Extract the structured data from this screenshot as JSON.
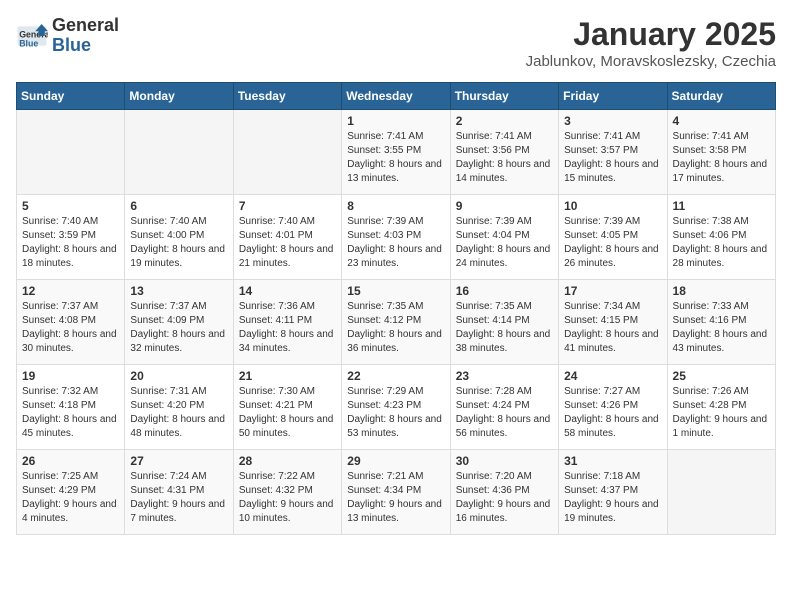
{
  "header": {
    "logo_general": "General",
    "logo_blue": "Blue",
    "title": "January 2025",
    "subtitle": "Jablunkov, Moravskoslezsky, Czechia"
  },
  "weekdays": [
    "Sunday",
    "Monday",
    "Tuesday",
    "Wednesday",
    "Thursday",
    "Friday",
    "Saturday"
  ],
  "weeks": [
    [
      {
        "day": "",
        "info": ""
      },
      {
        "day": "",
        "info": ""
      },
      {
        "day": "",
        "info": ""
      },
      {
        "day": "1",
        "info": "Sunrise: 7:41 AM\nSunset: 3:55 PM\nDaylight: 8 hours\nand 13 minutes."
      },
      {
        "day": "2",
        "info": "Sunrise: 7:41 AM\nSunset: 3:56 PM\nDaylight: 8 hours\nand 14 minutes."
      },
      {
        "day": "3",
        "info": "Sunrise: 7:41 AM\nSunset: 3:57 PM\nDaylight: 8 hours\nand 15 minutes."
      },
      {
        "day": "4",
        "info": "Sunrise: 7:41 AM\nSunset: 3:58 PM\nDaylight: 8 hours\nand 17 minutes."
      }
    ],
    [
      {
        "day": "5",
        "info": "Sunrise: 7:40 AM\nSunset: 3:59 PM\nDaylight: 8 hours\nand 18 minutes."
      },
      {
        "day": "6",
        "info": "Sunrise: 7:40 AM\nSunset: 4:00 PM\nDaylight: 8 hours\nand 19 minutes."
      },
      {
        "day": "7",
        "info": "Sunrise: 7:40 AM\nSunset: 4:01 PM\nDaylight: 8 hours\nand 21 minutes."
      },
      {
        "day": "8",
        "info": "Sunrise: 7:39 AM\nSunset: 4:03 PM\nDaylight: 8 hours\nand 23 minutes."
      },
      {
        "day": "9",
        "info": "Sunrise: 7:39 AM\nSunset: 4:04 PM\nDaylight: 8 hours\nand 24 minutes."
      },
      {
        "day": "10",
        "info": "Sunrise: 7:39 AM\nSunset: 4:05 PM\nDaylight: 8 hours\nand 26 minutes."
      },
      {
        "day": "11",
        "info": "Sunrise: 7:38 AM\nSunset: 4:06 PM\nDaylight: 8 hours\nand 28 minutes."
      }
    ],
    [
      {
        "day": "12",
        "info": "Sunrise: 7:37 AM\nSunset: 4:08 PM\nDaylight: 8 hours\nand 30 minutes."
      },
      {
        "day": "13",
        "info": "Sunrise: 7:37 AM\nSunset: 4:09 PM\nDaylight: 8 hours\nand 32 minutes."
      },
      {
        "day": "14",
        "info": "Sunrise: 7:36 AM\nSunset: 4:11 PM\nDaylight: 8 hours\nand 34 minutes."
      },
      {
        "day": "15",
        "info": "Sunrise: 7:35 AM\nSunset: 4:12 PM\nDaylight: 8 hours\nand 36 minutes."
      },
      {
        "day": "16",
        "info": "Sunrise: 7:35 AM\nSunset: 4:14 PM\nDaylight: 8 hours\nand 38 minutes."
      },
      {
        "day": "17",
        "info": "Sunrise: 7:34 AM\nSunset: 4:15 PM\nDaylight: 8 hours\nand 41 minutes."
      },
      {
        "day": "18",
        "info": "Sunrise: 7:33 AM\nSunset: 4:16 PM\nDaylight: 8 hours\nand 43 minutes."
      }
    ],
    [
      {
        "day": "19",
        "info": "Sunrise: 7:32 AM\nSunset: 4:18 PM\nDaylight: 8 hours\nand 45 minutes."
      },
      {
        "day": "20",
        "info": "Sunrise: 7:31 AM\nSunset: 4:20 PM\nDaylight: 8 hours\nand 48 minutes."
      },
      {
        "day": "21",
        "info": "Sunrise: 7:30 AM\nSunset: 4:21 PM\nDaylight: 8 hours\nand 50 minutes."
      },
      {
        "day": "22",
        "info": "Sunrise: 7:29 AM\nSunset: 4:23 PM\nDaylight: 8 hours\nand 53 minutes."
      },
      {
        "day": "23",
        "info": "Sunrise: 7:28 AM\nSunset: 4:24 PM\nDaylight: 8 hours\nand 56 minutes."
      },
      {
        "day": "24",
        "info": "Sunrise: 7:27 AM\nSunset: 4:26 PM\nDaylight: 8 hours\nand 58 minutes."
      },
      {
        "day": "25",
        "info": "Sunrise: 7:26 AM\nSunset: 4:28 PM\nDaylight: 9 hours\nand 1 minute."
      }
    ],
    [
      {
        "day": "26",
        "info": "Sunrise: 7:25 AM\nSunset: 4:29 PM\nDaylight: 9 hours\nand 4 minutes."
      },
      {
        "day": "27",
        "info": "Sunrise: 7:24 AM\nSunset: 4:31 PM\nDaylight: 9 hours\nand 7 minutes."
      },
      {
        "day": "28",
        "info": "Sunrise: 7:22 AM\nSunset: 4:32 PM\nDaylight: 9 hours\nand 10 minutes."
      },
      {
        "day": "29",
        "info": "Sunrise: 7:21 AM\nSunset: 4:34 PM\nDaylight: 9 hours\nand 13 minutes."
      },
      {
        "day": "30",
        "info": "Sunrise: 7:20 AM\nSunset: 4:36 PM\nDaylight: 9 hours\nand 16 minutes."
      },
      {
        "day": "31",
        "info": "Sunrise: 7:18 AM\nSunset: 4:37 PM\nDaylight: 9 hours\nand 19 minutes."
      },
      {
        "day": "",
        "info": ""
      }
    ]
  ]
}
